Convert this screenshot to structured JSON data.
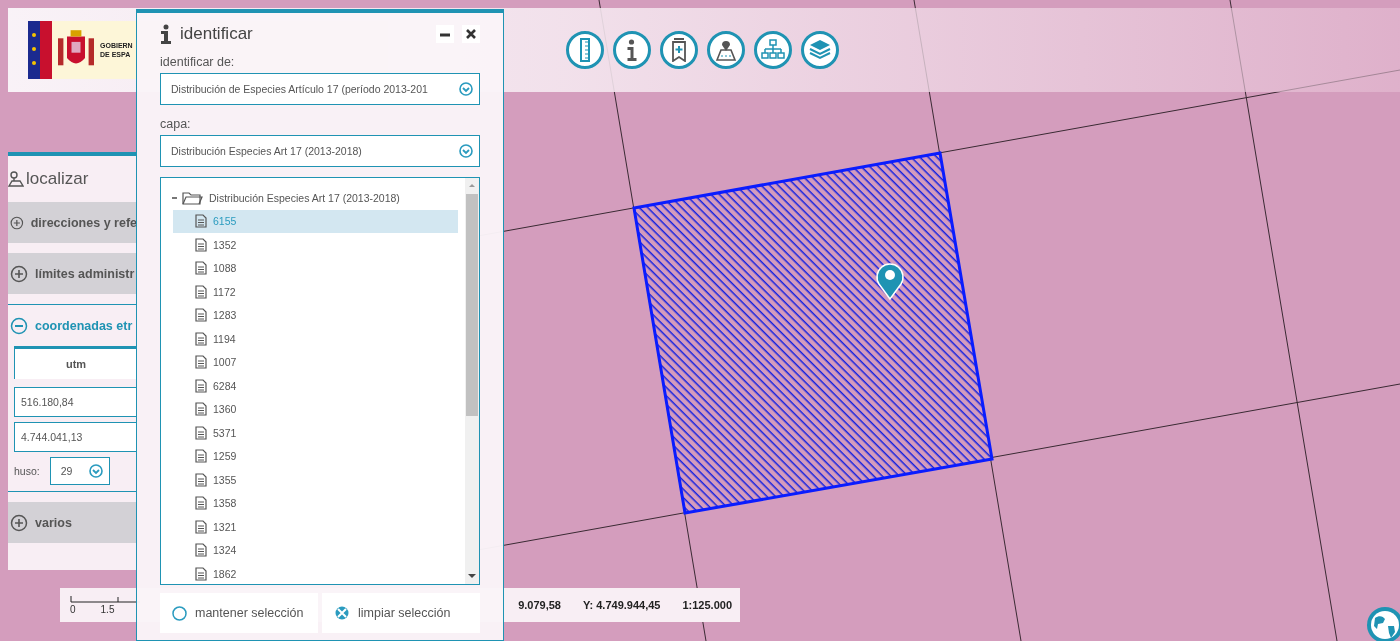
{
  "header": {
    "logo_text": [
      "GOBIERN",
      "DE ESPA"
    ]
  },
  "sidebar": {
    "title": "localizar",
    "sections": [
      {
        "label": "direcciones y refe",
        "expanded": false
      },
      {
        "label": "límites administr",
        "expanded": false
      },
      {
        "label": "coordenadas etr",
        "expanded": true,
        "tabs": [
          {
            "label": "utm",
            "selected": true
          }
        ],
        "fields": [
          {
            "value": "516.180,84"
          },
          {
            "value": "4.744.041,13"
          }
        ],
        "zone": {
          "label": "huso:",
          "value": "29"
        }
      },
      {
        "label": "varios",
        "expanded": false
      }
    ]
  },
  "dialog": {
    "title": "identificar",
    "source_label": "identificar de:",
    "source_value": "Distribución de Especies Artículo 17 (período 2013-201",
    "layer_label": "capa:",
    "layer_value": "Distribución Especies Art 17 (2013-2018)",
    "tree": {
      "label": "Distribución Especies Art 17 (2013-2018)",
      "expanded": true,
      "children": [
        {
          "label": "6155",
          "selected": true
        },
        {
          "label": "1352",
          "selected": false
        },
        {
          "label": "1088",
          "selected": false
        },
        {
          "label": "1172",
          "selected": false
        },
        {
          "label": "1283",
          "selected": false
        },
        {
          "label": "1194",
          "selected": false
        },
        {
          "label": "1007",
          "selected": false
        },
        {
          "label": "6284",
          "selected": false
        },
        {
          "label": "1360",
          "selected": false
        },
        {
          "label": "5371",
          "selected": false
        },
        {
          "label": "1259",
          "selected": false
        },
        {
          "label": "1355",
          "selected": false
        },
        {
          "label": "1358",
          "selected": false
        },
        {
          "label": "1321",
          "selected": false
        },
        {
          "label": "1324",
          "selected": false
        },
        {
          "label": "1862",
          "selected": false
        }
      ]
    },
    "keep_selection": {
      "label": "mantener selección",
      "checked": false
    },
    "clear_button": "limpiar selección"
  },
  "status_bar": {
    "scale_ticks": [
      "0",
      "1.5"
    ],
    "x_coord": "9.079,58",
    "y_coord": "Y: 4.749.944,45",
    "scale": "1:125.000"
  }
}
